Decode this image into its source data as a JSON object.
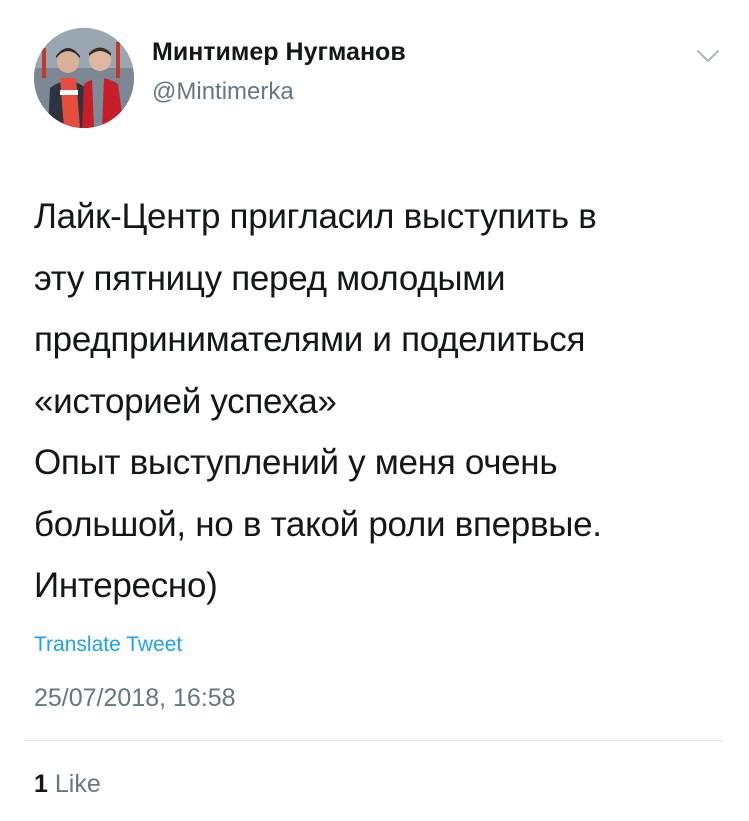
{
  "tweet": {
    "author_name": "Минтимер Нугманов",
    "author_handle": "@Mintimerka",
    "text_lines": [
      "Лайк-Центр пригласил выступить в",
      "эту пятницу перед молодыми",
      "предпринимателями и поделиться",
      "«историей успеха»",
      "Опыт выступлений у меня очень",
      "большой, но в такой роли впервые.",
      "Интересно)"
    ],
    "translate_label": "Translate Tweet",
    "timestamp": "25/07/2018, 16:58",
    "like_count": "1",
    "like_label": "Like"
  },
  "icons": {
    "menu": "chevron-down-icon"
  },
  "colors": {
    "text": "#14171a",
    "secondary": "#657786",
    "link": "#1da1f2",
    "divider": "#e1e8ed"
  }
}
